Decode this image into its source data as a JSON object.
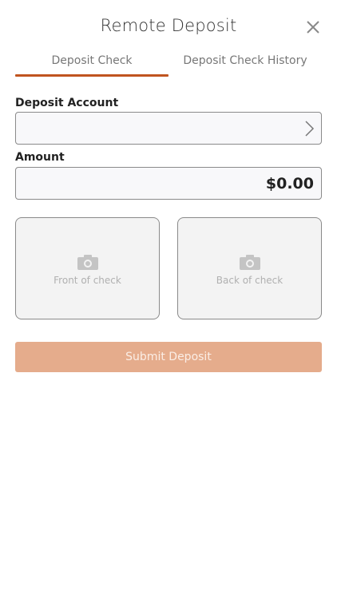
{
  "header": {
    "title": "Remote Deposit",
    "close_icon": "close-icon"
  },
  "tabs": [
    {
      "label": "Deposit Check",
      "active": true
    },
    {
      "label": "Deposit Check History",
      "active": false
    }
  ],
  "form": {
    "deposit_account": {
      "label": "Deposit Account",
      "value": "",
      "icon": "chevron-right-icon"
    },
    "amount": {
      "label": "Amount",
      "value": "$0.00"
    }
  },
  "check_images": {
    "front": {
      "caption": "Front of check",
      "icon": "camera-icon"
    },
    "back": {
      "caption": "Back of check",
      "icon": "camera-icon"
    }
  },
  "submit": {
    "label": "Submit Deposit",
    "enabled": false
  },
  "colors": {
    "accent": "#c0541f",
    "submit_disabled": "#e5ac8c",
    "field_bg": "#f8f8fa",
    "photo_bg": "#f3f3f3"
  }
}
